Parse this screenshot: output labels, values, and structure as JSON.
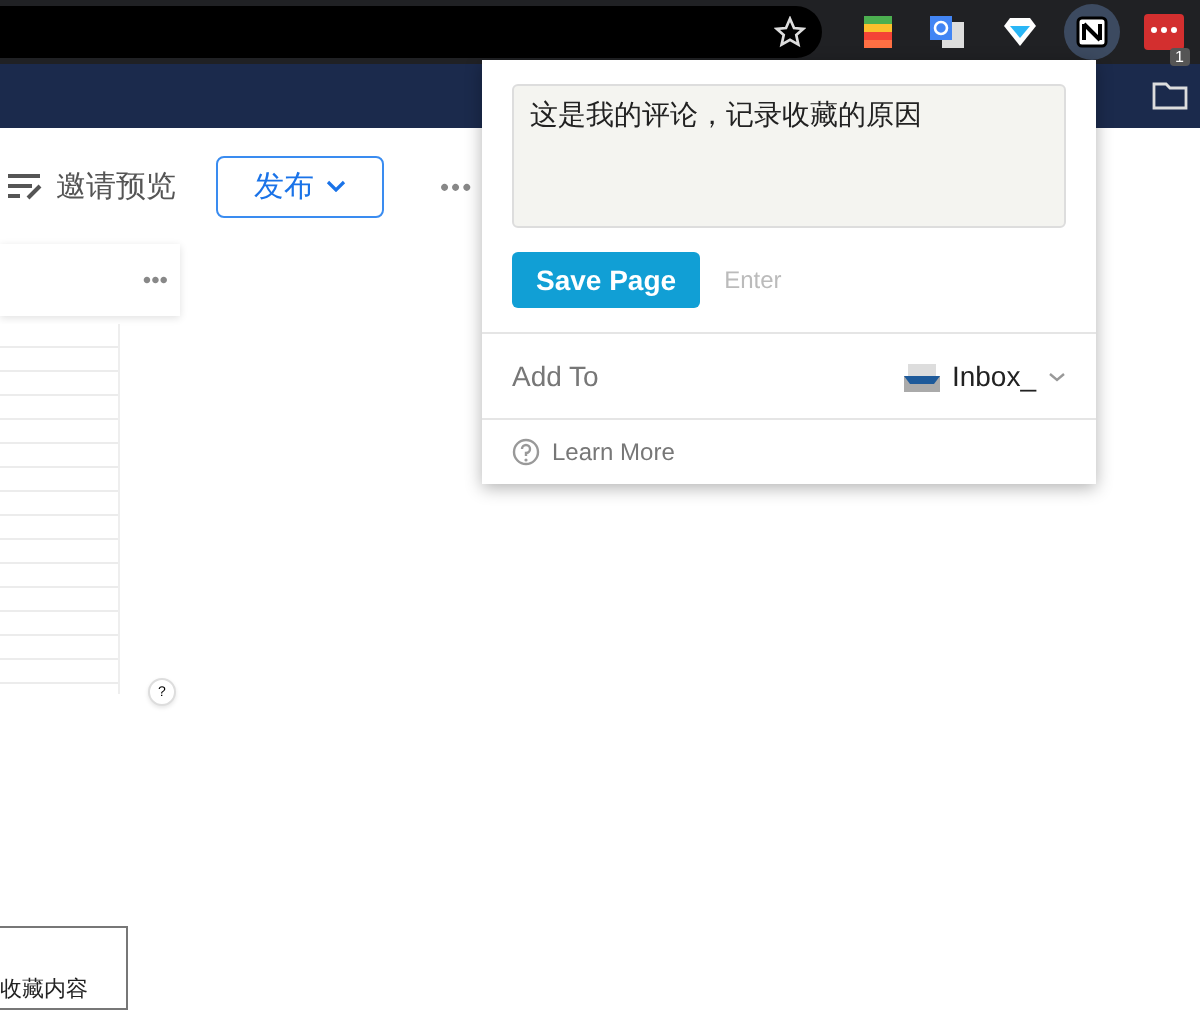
{
  "browser_toolbar": {
    "badge_count": "1"
  },
  "editor_toolbar": {
    "invite_preview": "邀请预览",
    "publish": "发布",
    "more": "•••"
  },
  "side_card": {
    "more": "•••"
  },
  "help": "?",
  "bottom_box": {
    "text": "收藏内容"
  },
  "clipper_popup": {
    "comment": "这是我的评论，记录收藏的原因",
    "save_button": "Save Page",
    "shortcut_hint": "Enter",
    "add_to_label": "Add To",
    "destination": "Inbox_",
    "learn_more": "Learn More"
  }
}
